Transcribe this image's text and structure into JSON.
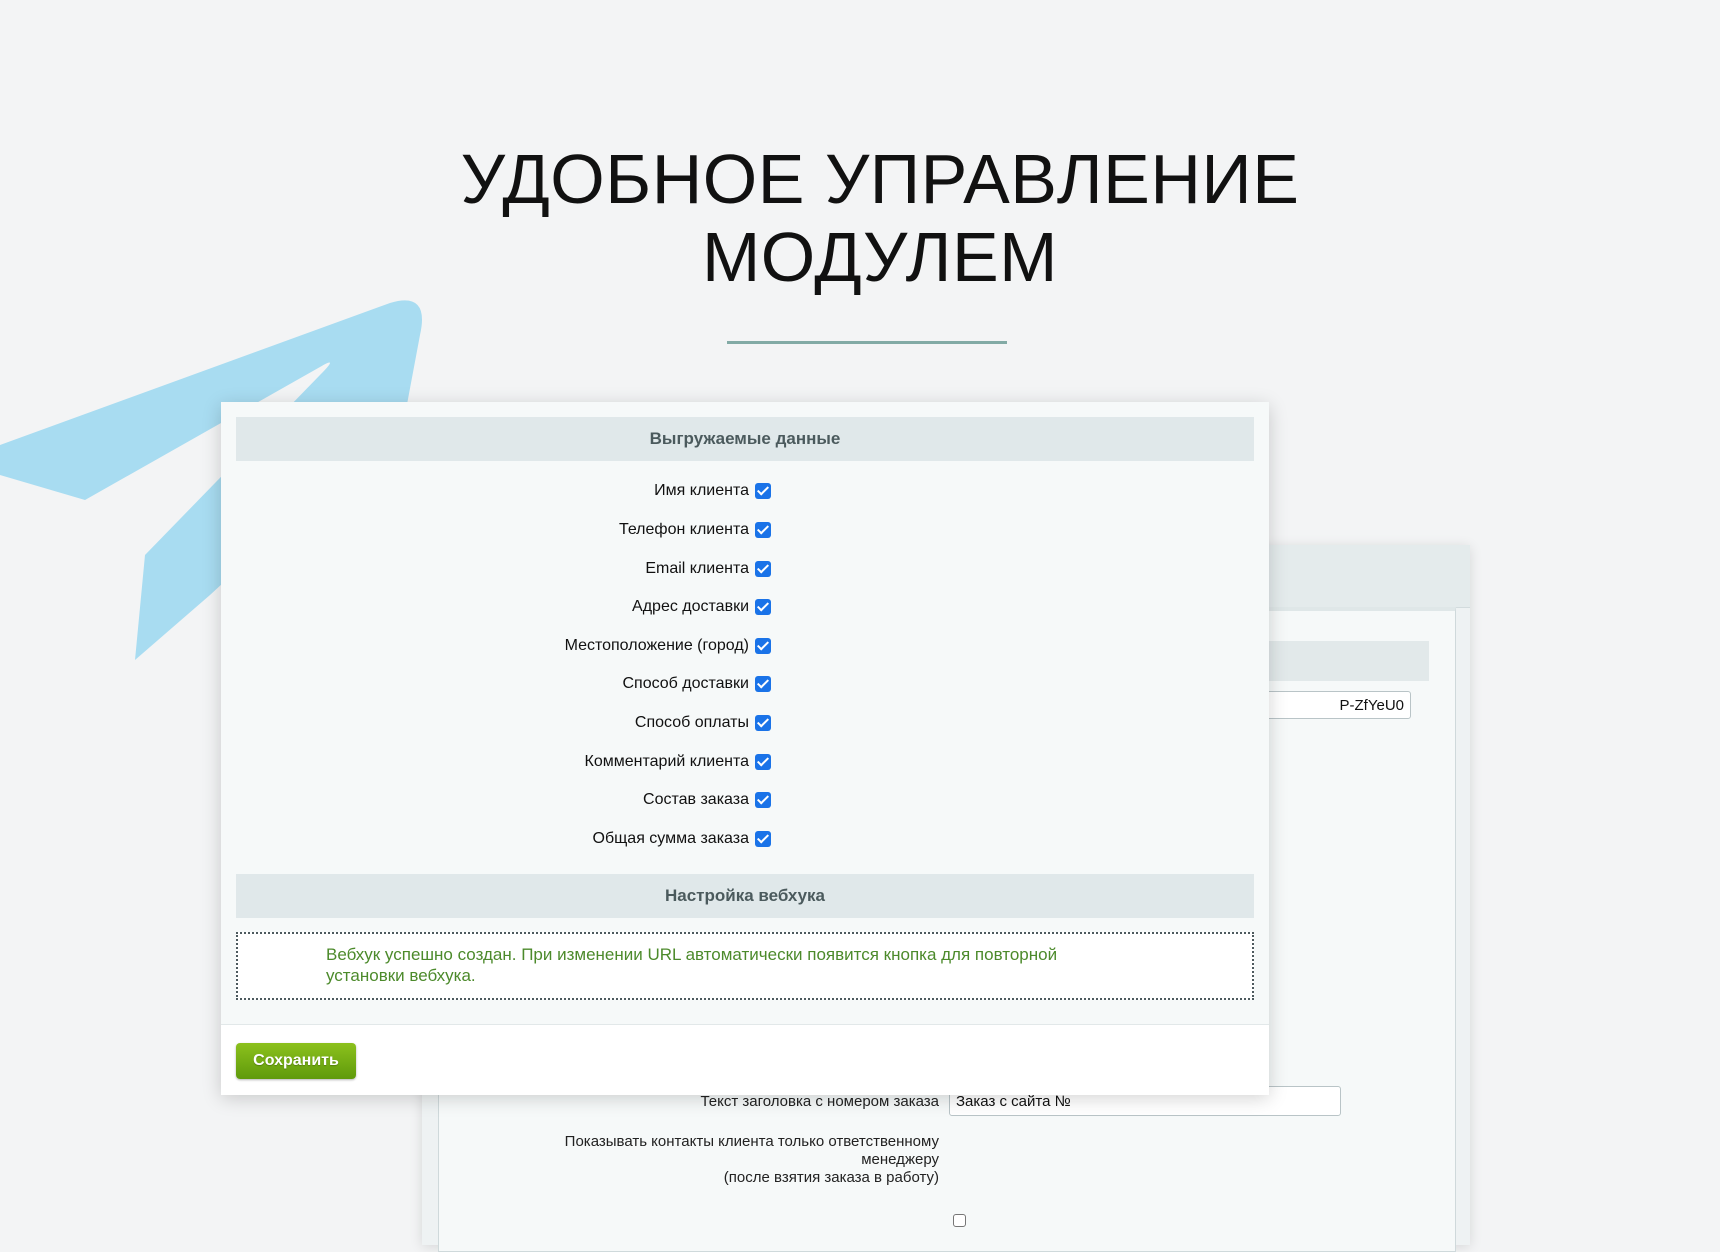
{
  "hero": {
    "title_line1": "УДОБНОЕ УПРАВЛЕНИЕ",
    "title_line2": "МОДУЛЕМ"
  },
  "colors": {
    "accent_divider": "#82aaa5",
    "checkbox": "#1a73e8",
    "notice_text": "#4c8a2b",
    "save_button": "#6fa712",
    "telegram_plane": "#a8dcf1"
  },
  "decor": {
    "background_icon": "telegram-plane-icon"
  },
  "front_panel": {
    "section1_title": "Выгружаемые данные",
    "fields": [
      {
        "label": "Имя клиента",
        "checked": true
      },
      {
        "label": "Телефон клиента",
        "checked": true
      },
      {
        "label": "Email клиента",
        "checked": true
      },
      {
        "label": "Адрес доставки",
        "checked": true
      },
      {
        "label": "Местоположение (город)",
        "checked": true
      },
      {
        "label": "Способ доставки",
        "checked": true
      },
      {
        "label": "Способ оплаты",
        "checked": true
      },
      {
        "label": "Комментарий клиента",
        "checked": true
      },
      {
        "label": "Состав заказа",
        "checked": true
      },
      {
        "label": "Общая сумма заказа",
        "checked": true
      }
    ],
    "section2_title": "Настройка вебхука",
    "notice": "Вебхук успешно создан. При изменении URL автоматически появится кнопка для повторной установки вебхука.",
    "save_label": "Сохранить"
  },
  "back_panel": {
    "token_value": "P-ZfYeU0",
    "header_text_label": "Текст заголовка с номером заказа",
    "header_text_value": "Заказ с сайта №",
    "contacts_label_line1": "Показывать контакты клиента только ответственному",
    "contacts_label_line2": "менеджеру",
    "contacts_label_line3": "(после взятия заказа в работу)",
    "contacts_checked": false
  }
}
